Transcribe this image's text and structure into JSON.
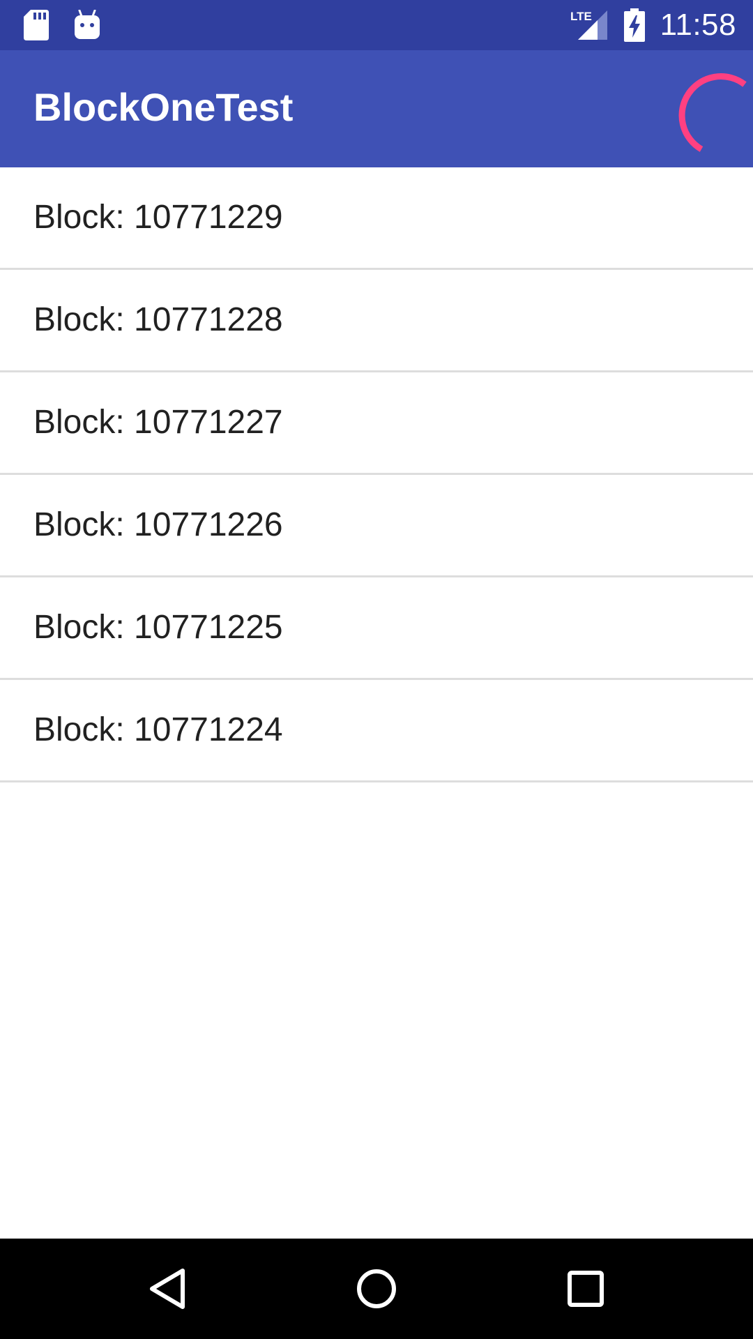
{
  "status_bar": {
    "left_icons": [
      "sd-card-icon",
      "android-icon"
    ],
    "network_label": "LTE",
    "time": "11:58",
    "background": "#303f9f"
  },
  "app_bar": {
    "title": "BlockOneTest",
    "background": "#3f51b5",
    "spinner_color": "#ff4081",
    "spinner_icon": "loading-spinner-icon"
  },
  "blocks": [
    {
      "label": "Block: 10771229"
    },
    {
      "label": "Block: 10771228"
    },
    {
      "label": "Block: 10771227"
    },
    {
      "label": "Block: 10771226"
    },
    {
      "label": "Block: 10771225"
    },
    {
      "label": "Block: 10771224"
    }
  ],
  "nav_bar": {
    "buttons": [
      "back-icon",
      "home-icon",
      "recents-icon"
    ]
  }
}
